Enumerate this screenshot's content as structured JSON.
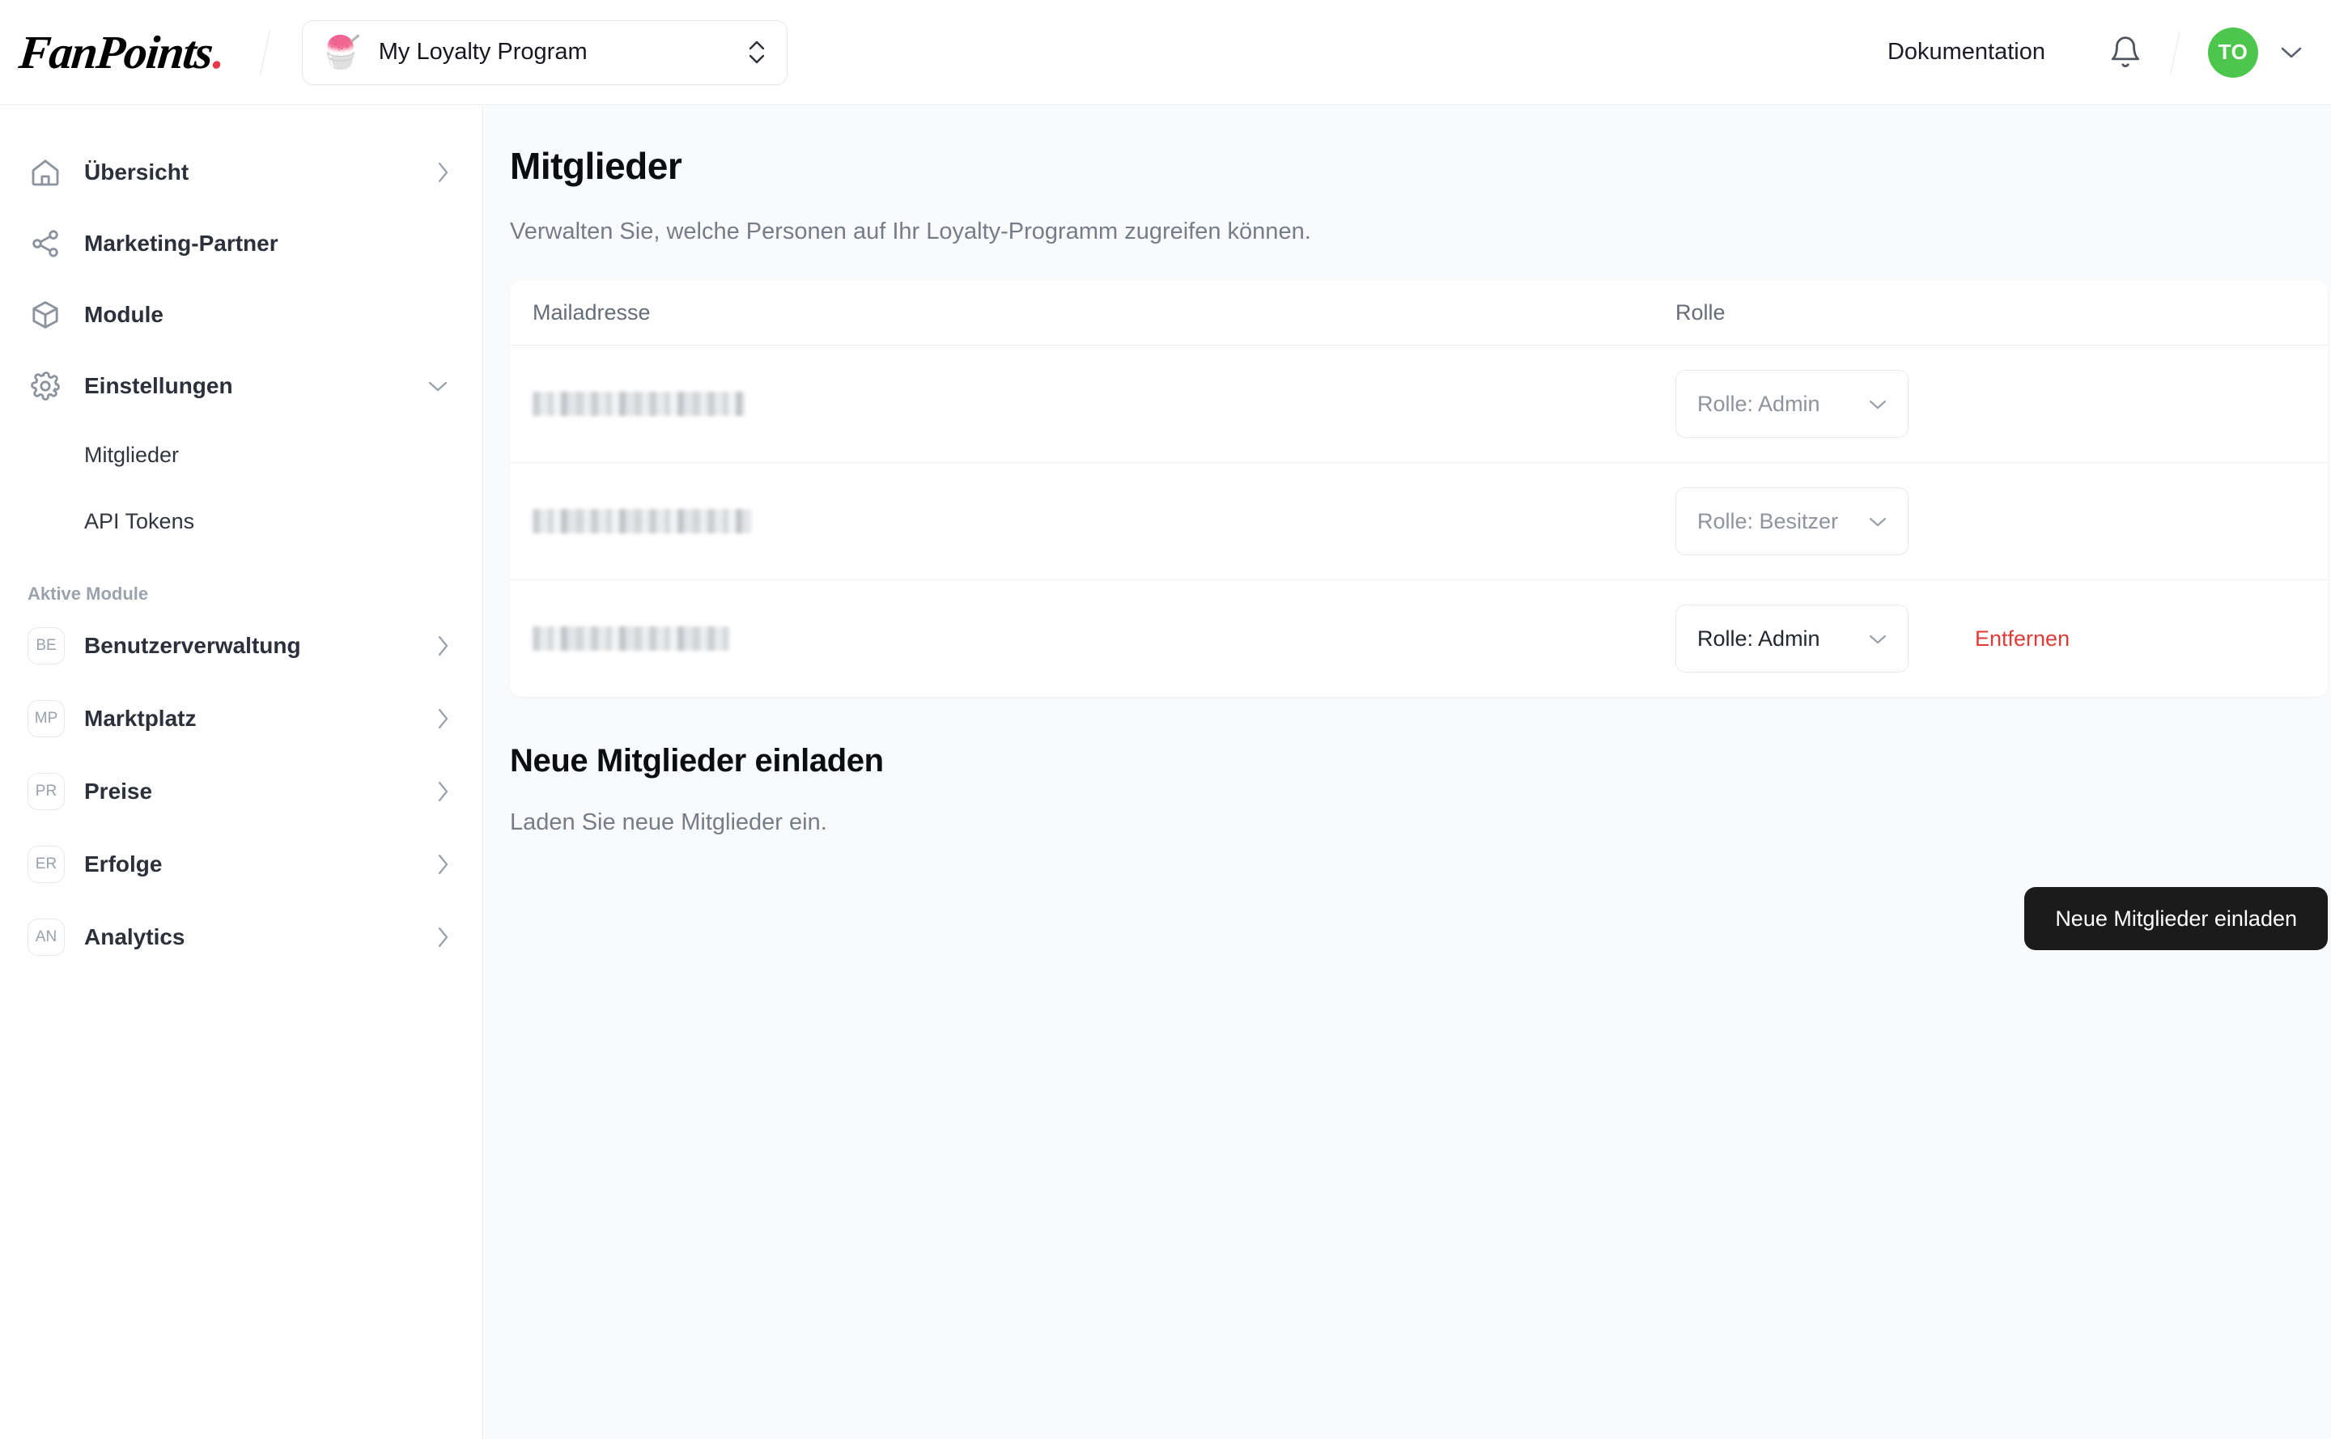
{
  "header": {
    "brand": "FanPoints",
    "brand_dot": ".",
    "program": {
      "emoji": "🍧",
      "name": "My Loyalty Program"
    },
    "doc_link": "Dokumentation",
    "avatar_initials": "TO",
    "accent_green": "#4CC64C"
  },
  "sidebar": {
    "items": [
      {
        "label": "Übersicht",
        "icon": "home-icon",
        "chevron": "right"
      },
      {
        "label": "Marketing-Partner",
        "icon": "share-icon",
        "chevron": "none"
      },
      {
        "label": "Module",
        "icon": "cube-icon",
        "chevron": "none"
      },
      {
        "label": "Einstellungen",
        "icon": "gear-icon",
        "chevron": "down"
      }
    ],
    "sub_items": [
      {
        "label": "Mitglieder"
      },
      {
        "label": "API Tokens"
      }
    ],
    "modules_section_label": "Aktive Module",
    "modules": [
      {
        "badge": "BE",
        "label": "Benutzerverwaltung"
      },
      {
        "badge": "MP",
        "label": "Marktplatz"
      },
      {
        "badge": "PR",
        "label": "Preise"
      },
      {
        "badge": "ER",
        "label": "Erfolge"
      },
      {
        "badge": "AN",
        "label": "Analytics"
      }
    ]
  },
  "main": {
    "title": "Mitglieder",
    "subtitle": "Verwalten Sie, welche Personen auf Ihr Loyalty-Programm zugreifen können.",
    "table": {
      "columns": [
        "Mailadresse",
        "Rolle"
      ],
      "rows": [
        {
          "email": "",
          "email_redacted": true,
          "role": "Rolle: Admin",
          "role_enabled": false,
          "remove": ""
        },
        {
          "email": "",
          "email_redacted": true,
          "role": "Rolle: Besitzer",
          "role_enabled": false,
          "remove": ""
        },
        {
          "email": "",
          "email_redacted": true,
          "role": "Rolle: Admin",
          "role_enabled": true,
          "remove": "Entfernen"
        }
      ]
    },
    "invite": {
      "heading": "Neue Mitglieder einladen",
      "description": "Laden Sie neue Mitglieder ein.",
      "button_label": "Neue Mitglieder einladen",
      "button_color": "#1b1b1b"
    }
  }
}
